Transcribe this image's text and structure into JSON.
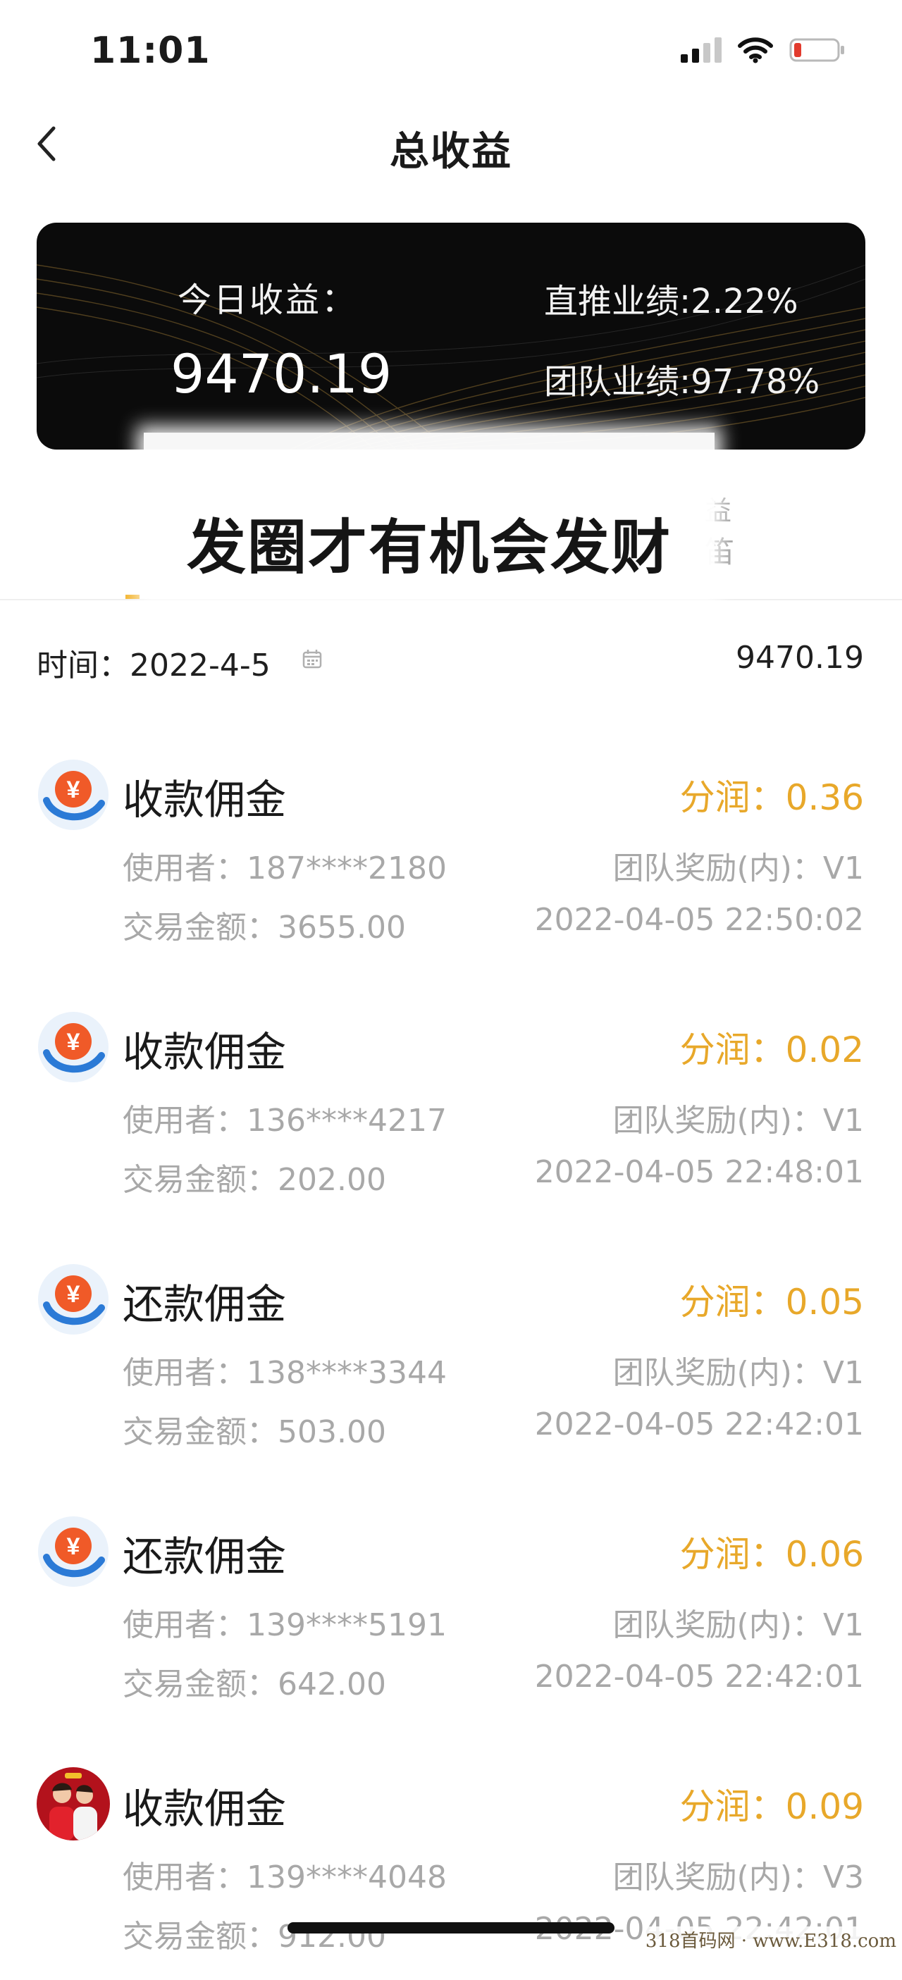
{
  "status_bar": {
    "time": "11:01"
  },
  "nav": {
    "title": "总收益",
    "back_icon": "chevron-left-icon"
  },
  "summary": {
    "today_label": "今日收益：",
    "today_value": "9470.19",
    "direct_perf": "直推业绩:2.22%",
    "team_perf": "团队业绩:97.78%"
  },
  "tabs": {
    "partial_top": "益",
    "partial_bottom": "笛"
  },
  "overlay": {
    "text": "发圈才有机会发财"
  },
  "date_row": {
    "label": "时间：2022-4-5",
    "total": "9470.19"
  },
  "records": [
    {
      "icon": "yuan-hand-icon",
      "type": "收款佣金",
      "share": "分润：0.36",
      "user": "使用者：187****2180",
      "level": "团队奖励(内)：V1",
      "amount": "交易金额：3655.00",
      "time": "2022-04-05 22:50:02"
    },
    {
      "icon": "yuan-hand-icon",
      "type": "收款佣金",
      "share": "分润：0.02",
      "user": "使用者：136****4217",
      "level": "团队奖励(内)：V1",
      "amount": "交易金额：202.00",
      "time": "2022-04-05 22:48:01"
    },
    {
      "icon": "yuan-hand-icon",
      "type": "还款佣金",
      "share": "分润：0.05",
      "user": "使用者：138****3344",
      "level": "团队奖励(内)：V1",
      "amount": "交易金额：503.00",
      "time": "2022-04-05 22:42:01"
    },
    {
      "icon": "yuan-hand-icon",
      "type": "还款佣金",
      "share": "分润：0.06",
      "user": "使用者：139****5191",
      "level": "团队奖励(内)：V1",
      "amount": "交易金额：642.00",
      "time": "2022-04-05 22:42:01"
    },
    {
      "icon": "user-avatar-icon",
      "type": "收款佣金",
      "share": "分润：0.09",
      "user": "使用者：139****4048",
      "level": "团队奖励(内)：V3",
      "amount": "交易金额：912.00",
      "time": "2022-04-05 22:42:01"
    }
  ],
  "watermark": "318首码网 · www.E318.com",
  "colors": {
    "accent": "#f3b32a",
    "share_text": "#e8a82a",
    "muted_text": "#a8a8a8",
    "card_bg": "#0b0b0b"
  }
}
